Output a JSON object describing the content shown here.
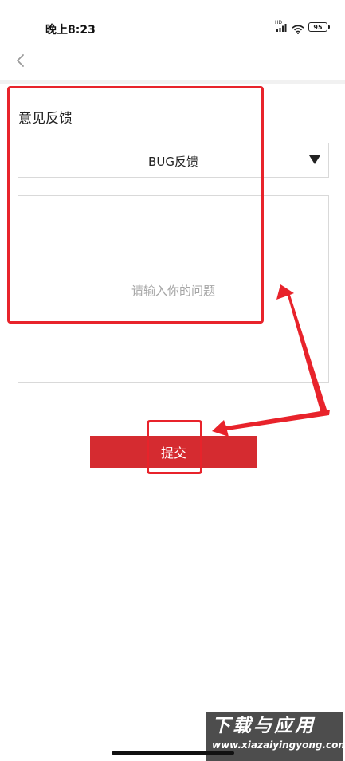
{
  "status_bar": {
    "time": "晚上8:23",
    "network_label": "HD",
    "battery_level": "95",
    "icons": [
      "signal-icon",
      "wifi-icon",
      "battery-icon"
    ]
  },
  "nav": {
    "back_icon": "chevron-left-icon"
  },
  "feedback": {
    "title": "意见反馈",
    "type_select": {
      "value": "BUG反馈",
      "arrow_icon": "caret-down-icon"
    },
    "textarea_placeholder": "请输入你的问题",
    "submit_label": "提交"
  },
  "annotations": {
    "highlight_color": "#e8232b"
  },
  "colors": {
    "accent": "#d52b30",
    "placeholder": "#a5a5a5",
    "border": "#d9d9d9"
  },
  "watermark": {
    "title": "下载与应用",
    "url": "www.xiazaiyingyong.com"
  }
}
